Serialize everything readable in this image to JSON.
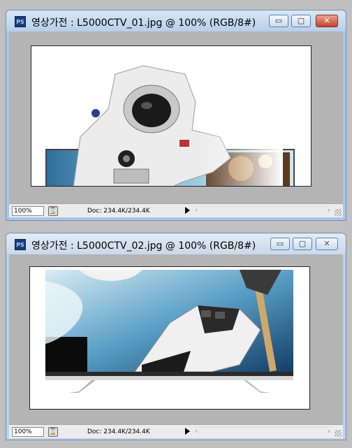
{
  "windows": [
    {
      "title": "영상가전 : L5000CTV_01.jpg @ 100% (RGB/8#)",
      "app_icon": "PS",
      "zoom": "100%",
      "doc_info": "Doc: 234.4K/234.4K",
      "controls": {
        "minimize": "▭",
        "maximize": "▢",
        "close": "✕"
      }
    },
    {
      "title": "영상가전 : L5000CTV_02.jpg @ 100% (RGB/8#)",
      "app_icon": "PS",
      "zoom": "100%",
      "doc_info": "Doc: 234.4K/234.4K",
      "controls": {
        "minimize": "▭",
        "maximize": "▢",
        "close": "✕"
      }
    }
  ],
  "status_icon": "⌛",
  "colors": {
    "workspace": "#c0c0c0",
    "canvas_bg": "#b4b4b4",
    "close_active": "#c7442a"
  },
  "icons": [
    "ps-app-icon",
    "minimize-icon",
    "maximize-icon",
    "close-icon",
    "status-options-icon",
    "scroll-arrow-icon",
    "resize-grip-icon"
  ]
}
